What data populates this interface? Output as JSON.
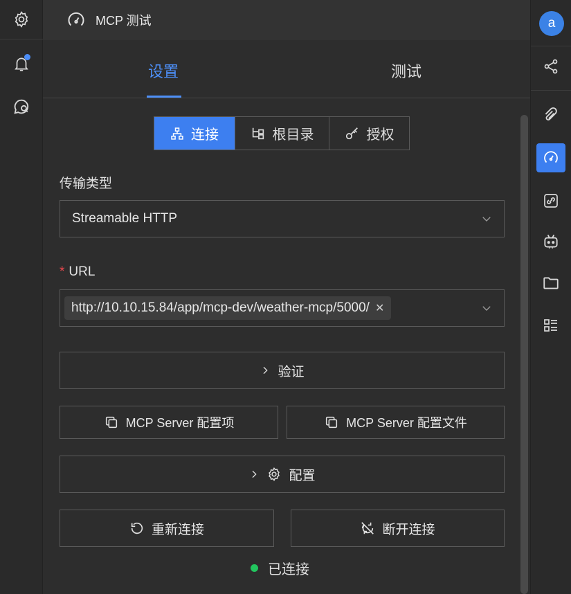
{
  "left_rail": {
    "items": [
      {
        "name": "settings",
        "icon": "gear-icon"
      },
      {
        "name": "notifications",
        "icon": "bell-icon",
        "has_badge": true
      },
      {
        "name": "chat",
        "icon": "chat-icon"
      }
    ]
  },
  "header": {
    "title": "MCP 测试",
    "icon": "gauge-icon"
  },
  "tabs": [
    {
      "label": "设置",
      "active": true
    },
    {
      "label": "测试",
      "active": false
    }
  ],
  "segments": [
    {
      "label": "连接",
      "icon": "network-icon",
      "active": true
    },
    {
      "label": "根目录",
      "icon": "tree-icon",
      "active": false
    },
    {
      "label": "授权",
      "icon": "key-icon",
      "active": false
    }
  ],
  "form": {
    "transport_label": "传输类型",
    "transport_value": "Streamable HTTP",
    "url_required_mark": "*",
    "url_label": "URL",
    "url_value": "http://10.10.15.84/app/mcp-dev/weather-mcp/5000/"
  },
  "buttons": {
    "verify": "验证",
    "server_config_item": "MCP Server 配置项",
    "server_config_file": "MCP Server 配置文件",
    "config": "配置",
    "reconnect": "重新连接",
    "disconnect": "断开连接"
  },
  "status": {
    "text": "已连接",
    "color": "#22c55e"
  },
  "right_rail": {
    "avatar_letter": "a",
    "items": [
      "share-icon",
      "paperclip-icon",
      "gauge-icon",
      "link-icon",
      "robot-icon",
      "folder-icon",
      "list-icon"
    ],
    "active": "gauge-icon"
  },
  "colors": {
    "accent": "#3d7ff0",
    "background": "#2d2d2d",
    "danger": "#e5484d"
  }
}
